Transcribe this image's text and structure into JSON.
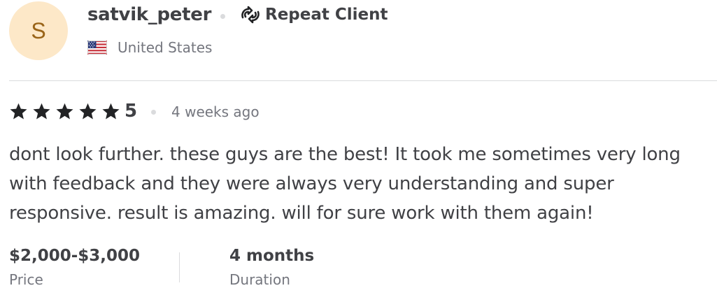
{
  "reviewer": {
    "avatar_initial": "S",
    "username": "satvik_peter",
    "badge_label": "Repeat Client",
    "badge_icon": "repeat-icon",
    "country": "United States",
    "country_flag": "us-flag-icon"
  },
  "rating": {
    "stars_filled": 5,
    "stars_total": 5,
    "value_label": "5",
    "time_ago": "4 weeks ago"
  },
  "review": {
    "text": "dont look further. these guys are the best! It took me sometimes very long with feedback and they were always very understanding and super responsive. result is amazing. will for sure work with them again!"
  },
  "details": {
    "price_value": "$2,000-$3,000",
    "price_label": "Price",
    "duration_value": "4 months",
    "duration_label": "Duration"
  },
  "colors": {
    "text_primary": "#404145",
    "text_secondary": "#74767e",
    "avatar_bg": "#fde8c8",
    "avatar_text": "#9a6418",
    "divider": "#dadbdd",
    "star": "#222325"
  }
}
